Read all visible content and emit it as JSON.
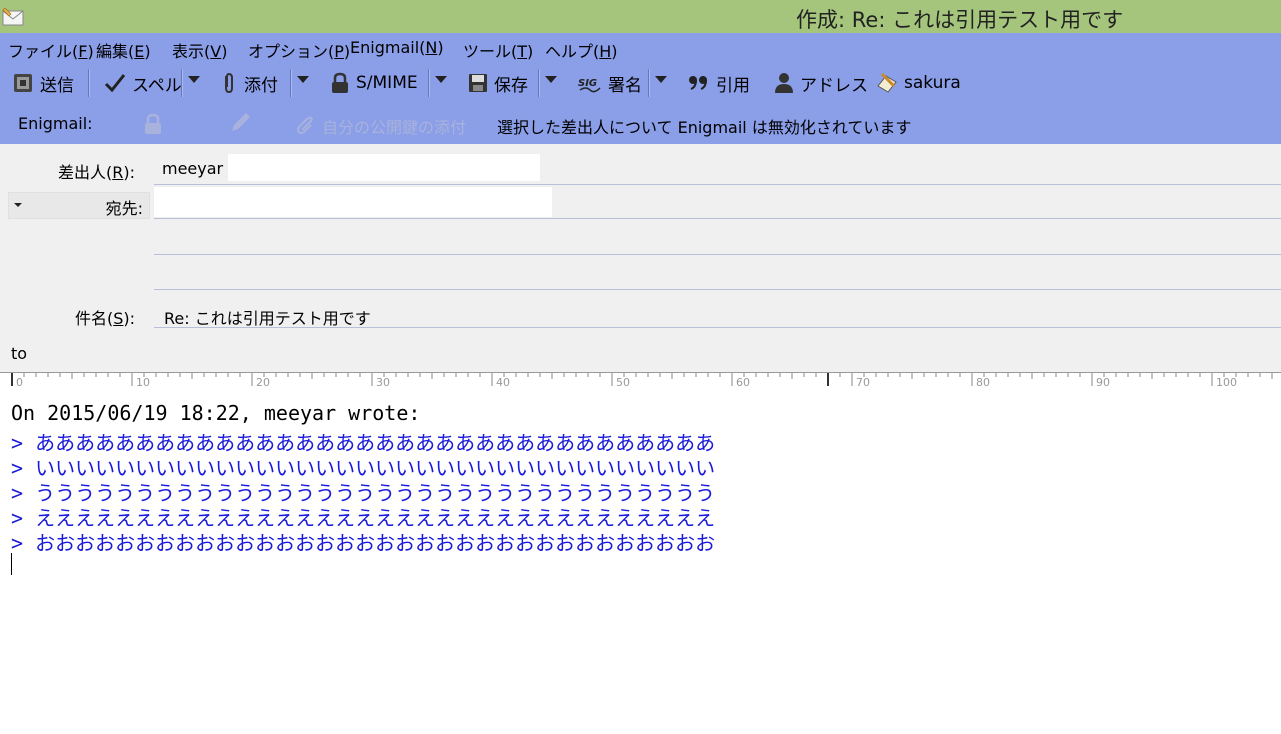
{
  "window": {
    "title": "作成: Re: これは引用テスト用です"
  },
  "menu": [
    {
      "label": "ファイル(",
      "key": "F",
      "close": ")"
    },
    {
      "label": "編集(",
      "key": "E",
      "close": ")"
    },
    {
      "label": "表示(",
      "key": "V",
      "close": ")"
    },
    {
      "label": "オプション(",
      "key": "P",
      "close": ")"
    },
    {
      "label": "Enigmail(",
      "key": "N",
      "close": ")"
    },
    {
      "label": "ツール(",
      "key": "T",
      "close": ")"
    },
    {
      "label": "ヘルプ(",
      "key": "H",
      "close": ")"
    }
  ],
  "toolbar": {
    "send": "送信",
    "spell": "スペル",
    "attach": "添付",
    "smime": "S/MIME",
    "save": "保存",
    "sign": "署名",
    "sig_icon_text": "SIG",
    "quote": "引用",
    "address": "アドレス",
    "sakura": "sakura"
  },
  "enigmail": {
    "label": "Enigmail:",
    "attach_key": "自分の公開鍵の添付",
    "status": "選択した差出人について Enigmail は無効化されています"
  },
  "header": {
    "from_label_a": "差出人(",
    "from_label_key": "R",
    "from_label_b": "):",
    "from_value": "meeyar",
    "to_label": "宛先:",
    "subject_label_a": "件名(",
    "subject_label_key": "S",
    "subject_label_b": "):",
    "subject_value": "Re: これは引用テスト用です",
    "attachment_text": "to"
  },
  "ruler": {
    "labels": [
      "0",
      "10",
      "20",
      "30",
      "40",
      "50",
      "60",
      "70",
      "80",
      "90",
      "100"
    ]
  },
  "body": {
    "attribution": "On 2015/06/19 18:22, meeyar wrote:",
    "quotes": [
      "> ああああああああああああああああああああああああああああああああああ",
      "> いいいいいいいいいいいいいいいいいいいいいいいいいいいいいいいいいい",
      "> うううううううううううううううううううううううううううううううううう",
      "> ええええええええええええええええええええええええええええええええええ",
      "> おおおおおおおおおおおおおおおおおおおおおおおおおおおおおおおおおお"
    ]
  },
  "colors": {
    "titlebar": "#a5c57d",
    "toolbar": "#8b9ee8",
    "quote_text": "#1a1adb"
  }
}
